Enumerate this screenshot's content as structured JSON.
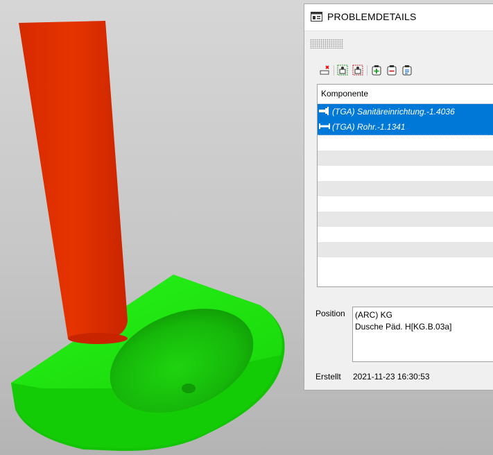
{
  "panel": {
    "title": "PROBLEMDETAILS",
    "title_icon": "panel-window-icon"
  },
  "toolbar": {
    "buttons": [
      {
        "name": "remove-red-x-icon"
      },
      {
        "name": "select-components-icon"
      },
      {
        "name": "deselect-components-icon"
      },
      {
        "name": "add-plus-icon"
      },
      {
        "name": "remove-minus-icon"
      },
      {
        "name": "clipboard-list-icon"
      }
    ]
  },
  "grid": {
    "header": "Komponente",
    "rows": [
      {
        "text": "(TGA) Sanitäreinrichtung.-1.4036",
        "icon": "sanitary-fixture-icon"
      },
      {
        "text": "(TGA) Rohr.-1.1341",
        "icon": "pipe-icon"
      }
    ]
  },
  "details": {
    "position_label": "Position",
    "position_lines": [
      "(ARC) KG",
      "Dusche Päd. H[KG.B.03a]"
    ],
    "created_label": "Erstellt",
    "created_value": "2021-11-23 16:30:53"
  },
  "colors": {
    "pipe": "#e03000",
    "shower_tray": "#1fe000",
    "selection": "#0078d7",
    "viewport_bg": "#cccccc"
  }
}
